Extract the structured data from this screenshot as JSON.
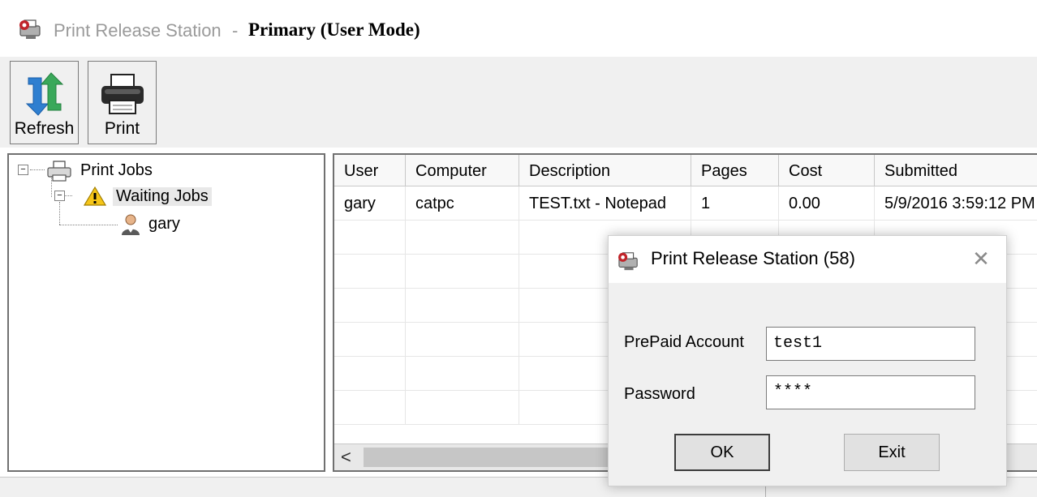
{
  "window": {
    "title": "Print Release Station",
    "title_separator": "-",
    "mode": "Primary (User Mode)"
  },
  "toolbar": {
    "refresh_label": "Refresh",
    "print_label": "Print",
    "refresh_icon": "refresh-arrows-icon",
    "print_icon": "printer-icon"
  },
  "tree": {
    "root_label": "Print Jobs",
    "child_label": "Waiting Jobs",
    "user_label": "gary",
    "root_icon": "printer-icon",
    "child_icon": "warning-icon",
    "user_icon": "user-icon"
  },
  "grid": {
    "columns": [
      "User",
      "Computer",
      "Description",
      "Pages",
      "Cost",
      "Submitted"
    ],
    "rows": [
      [
        "gary",
        "catpc",
        "TEST.txt - Notepad",
        "1",
        "0.00",
        "5/9/2016 3:59:12 PM"
      ]
    ],
    "scroll_left": "<"
  },
  "dialog": {
    "title": "Print Release Station (58)",
    "close_symbol": "✕",
    "account_label": "PrePaid Account",
    "account_value": "test1",
    "password_label": "Password",
    "password_value": "****",
    "ok_label": "OK",
    "exit_label": "Exit"
  },
  "colors": {
    "accent_green": "#3aa85a",
    "accent_blue": "#2f7fd0",
    "warning_yellow": "#f5c518"
  }
}
